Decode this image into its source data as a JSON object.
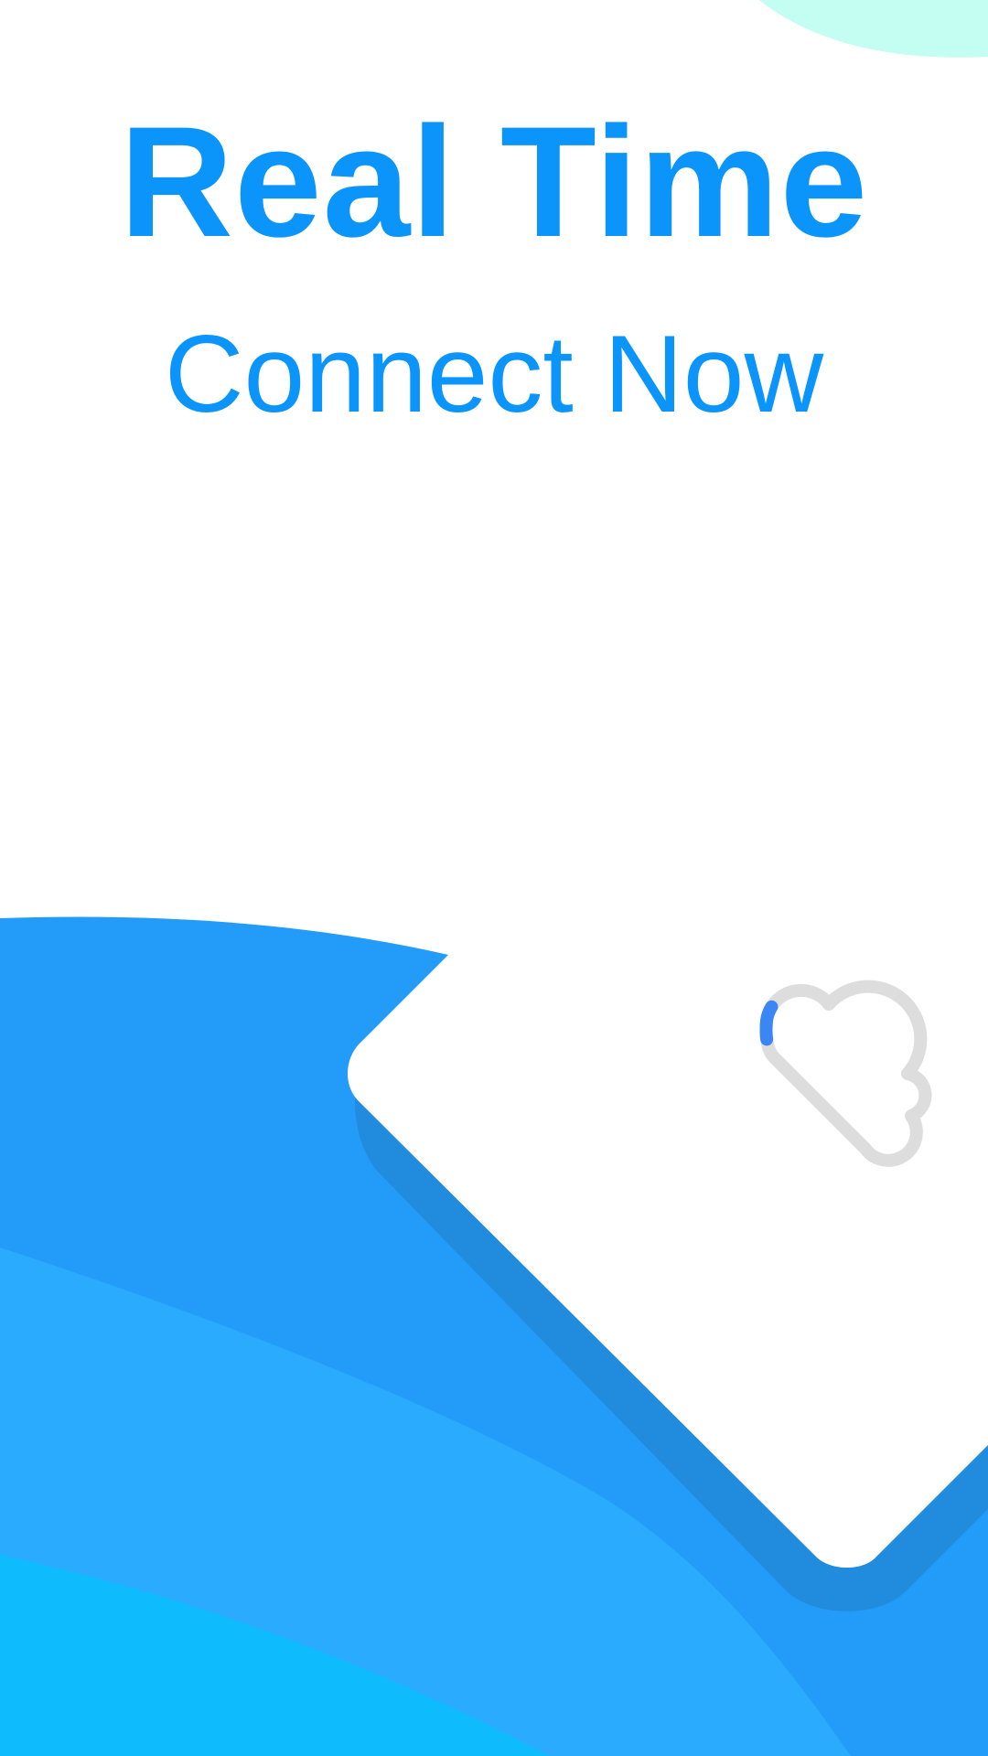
{
  "header": {
    "title": "Real Time",
    "subtitle": "Connect Now"
  },
  "loader": {
    "icon": "cloud-icon",
    "progress": 0.06
  },
  "colors": {
    "text_primary": "#0b95fb",
    "mint_accent": "#c4fdf1",
    "blue_primary": "#229bf9",
    "blue_light": "#2aabfe",
    "cyan": "#0ebcfe",
    "shadow_blue": "#218cde",
    "card_white": "#ffffff",
    "loader_track": "#dddddd",
    "loader_progress": "#3b86f5"
  }
}
